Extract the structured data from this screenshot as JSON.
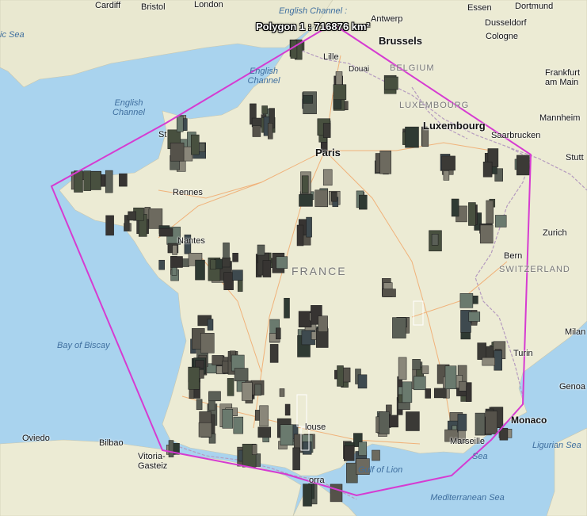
{
  "polygon_label": "Polygon 1 : 716876 km²",
  "colors": {
    "sea": "#a9d3ee",
    "land": "#ecebd4",
    "polygon": "#d63bd1",
    "tile": "#3a3a38"
  },
  "labels": {
    "cardiff": "Cardiff",
    "bristol": "Bristol",
    "london": "London",
    "english_channel_top": "English Channel :",
    "antwerp": "Antwerp",
    "essen": "Essen",
    "dortmund": "Dortmund",
    "dusseldorf": "Dusseldorf",
    "cologne": "Cologne",
    "celtic_sea": "ic Sea",
    "brussels": "Brussels",
    "lille": "Lille",
    "douai": "Douai",
    "belgium": "BELGIUM",
    "frankfurt": "Frankfurt am Main",
    "english_channel_mid": "English Channel",
    "english_channel_left": "English Channel",
    "luxembourg_country": "LUXEMBOURG",
    "luxembourg_city": "Luxembourg",
    "mannheim": "Mannheim",
    "saarbrucken": "Saarbrucken",
    "stuttgart": "Stutt",
    "paris": "Paris",
    "rennes": "Rennes",
    "nantes": "Nantes",
    "zurich": "Zurich",
    "bern": "Bern",
    "switzerland": "SWITZERLAND",
    "france": "FRANCE",
    "bay_of_biscay": "Bay of Biscay",
    "milan": "Milan",
    "turin": "Turin",
    "genoa": "Genoa",
    "monaco": "Monaco",
    "ligurian_sea": "Ligurian Sea",
    "oviedo": "Oviedo",
    "bilbao": "Bilbao",
    "vitoria": "Vitoria-Gasteiz",
    "toulouse": "louse",
    "marseille": "Marseille",
    "gulf_of_lion": "Gulf of Lion",
    "andorra": "orra",
    "mediterranean": "Mediterranean Sea",
    "stmalo": "St"
  }
}
